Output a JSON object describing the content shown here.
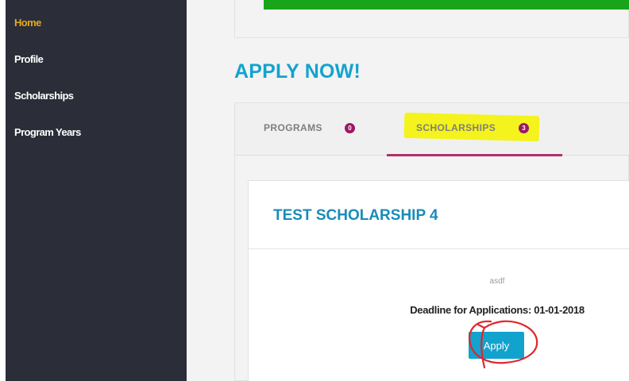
{
  "sidebar": {
    "items": [
      {
        "label": "Home",
        "active": true
      },
      {
        "label": "Profile",
        "active": false
      },
      {
        "label": "Scholarships",
        "active": false
      },
      {
        "label": "Program Years",
        "active": false
      }
    ]
  },
  "progress": {
    "percent": 100,
    "color": "#18a51a"
  },
  "main": {
    "heading": "APPLY NOW!",
    "tabs": [
      {
        "label": "PROGRAMS",
        "count": "0",
        "selected": false
      },
      {
        "label": "SCHOLARSHIPS",
        "count": "3",
        "selected": true,
        "highlighted": true
      }
    ],
    "scholarship": {
      "title": "TEST SCHOLARSHIP 4",
      "description": "asdf",
      "deadline": "Deadline for Applications: 01-01-2018",
      "apply_label": "Apply"
    }
  },
  "colors": {
    "sidebar_bg": "#2b2e38",
    "active_nav": "#e6a81e",
    "accent": "#13a3cf",
    "badge": "#9c1865",
    "tab_underline": "#b0306f",
    "highlight": "#f4f31d",
    "annotation": "#e0262a"
  },
  "annotations": {
    "red_circle_icon": "hand-drawn-circle-icon"
  }
}
